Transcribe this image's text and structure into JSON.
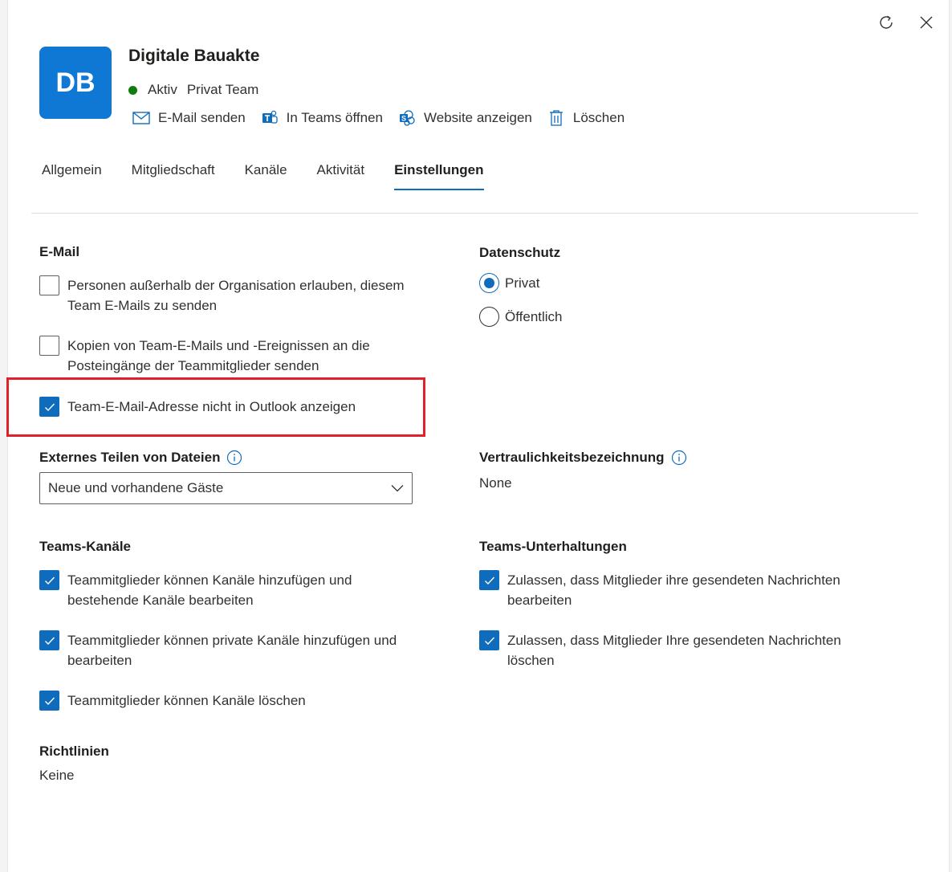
{
  "header": {
    "avatar_initials": "DB",
    "title": "Digitale Bauakte",
    "status": "Aktiv",
    "privacy_type": "Privat Team",
    "refresh_icon": "refresh-icon",
    "close_icon": "close-icon",
    "actions": [
      {
        "label": "E-Mail senden",
        "icon": "mail-icon"
      },
      {
        "label": "In Teams öffnen",
        "icon": "teams-icon"
      },
      {
        "label": "Website anzeigen",
        "icon": "sharepoint-icon"
      },
      {
        "label": "Löschen",
        "icon": "trash-icon"
      }
    ]
  },
  "tabs": [
    "Allgemein",
    "Mitgliedschaft",
    "Kanäle",
    "Aktivität",
    "Einstellungen"
  ],
  "active_tab": "Einstellungen",
  "email": {
    "title": "E-Mail",
    "options": [
      {
        "label_line1": "Personen außerhalb der Organisation erlauben, diesem",
        "label_line2": "Team E-Mails zu senden",
        "checked": false
      },
      {
        "label_line1": "Kopien von Team-E-Mails und -Ereignissen an die",
        "label_line2": "Posteingänge der Teammitglieder senden",
        "checked": false
      },
      {
        "label_line1": "Team-E-Mail-Adresse nicht in Outlook anzeigen",
        "label_line2": "",
        "checked": true
      }
    ]
  },
  "privacy": {
    "title": "Datenschutz",
    "options": [
      {
        "label": "Privat",
        "selected": true
      },
      {
        "label": "Öffentlich",
        "selected": false
      }
    ]
  },
  "external_sharing": {
    "title": "Externes Teilen von Dateien",
    "selected": "Neue und vorhandene Gäste"
  },
  "sensitivity": {
    "title": "Vertraulichkeitsbezeichnung",
    "value": "None"
  },
  "teams_channels": {
    "title": "Teams-Kanäle",
    "options": [
      {
        "label_line1": "Teammitglieder können Kanäle hinzufügen und",
        "label_line2": "bestehende Kanäle bearbeiten",
        "checked": true
      },
      {
        "label_line1": "Teammitglieder können private Kanäle hinzufügen und",
        "label_line2": "bearbeiten",
        "checked": true
      },
      {
        "label_line1": "Teammitglieder können Kanäle löschen",
        "label_line2": "",
        "checked": true
      }
    ]
  },
  "teams_conversations": {
    "title": "Teams-Unterhaltungen",
    "options": [
      {
        "label_line1": "Zulassen, dass Mitglieder ihre gesendeten Nachrichten",
        "label_line2": "bearbeiten",
        "checked": true
      },
      {
        "label_line1": "Zulassen, dass Mitglieder Ihre gesendeten Nachrichten",
        "label_line2": "löschen",
        "checked": true
      }
    ]
  },
  "policies": {
    "title": "Richtlinien",
    "value": "Keine"
  },
  "colors": {
    "accent": "#0f6cbd",
    "avatar": "#0f78d4",
    "status_active": "#107c10",
    "highlight": "#e0202a"
  }
}
